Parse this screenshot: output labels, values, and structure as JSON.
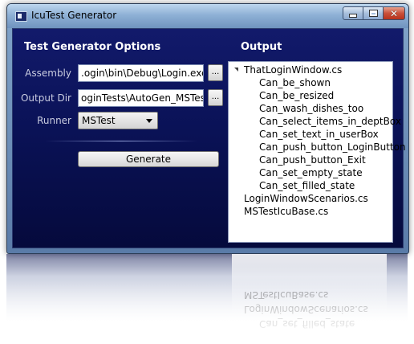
{
  "window": {
    "title": "IcuTest Generator"
  },
  "options": {
    "heading": "Test Generator Options",
    "assembly_label": "Assembly",
    "assembly_value": ".ogin\\bin\\Debug\\Login.exe",
    "output_dir_label": "Output Dir",
    "output_dir_value": "oginTests\\AutoGen_MSTest",
    "browse_label": "...",
    "runner_label": "Runner",
    "runner_value": "MSTest",
    "generate_label": "Generate"
  },
  "output": {
    "heading": "Output",
    "root": "ThatLoginWindow.cs",
    "children": [
      "Can_be_shown",
      "Can_be_resized",
      "Can_wash_dishes_too",
      "Can_select_items_in_deptBox",
      "Can_set_text_in_userBox",
      "Can_push_button_LoginButton",
      "Can_push_button_Exit",
      "Can_set_empty_state",
      "Can_set_filled_state"
    ],
    "files": [
      "LoginWindowScenarios.cs",
      "MSTestIcuBase.cs"
    ]
  },
  "colors": {
    "client_bg": "#0a1257",
    "title_bar": "#8fb1d6",
    "close_button": "#c9503a"
  }
}
